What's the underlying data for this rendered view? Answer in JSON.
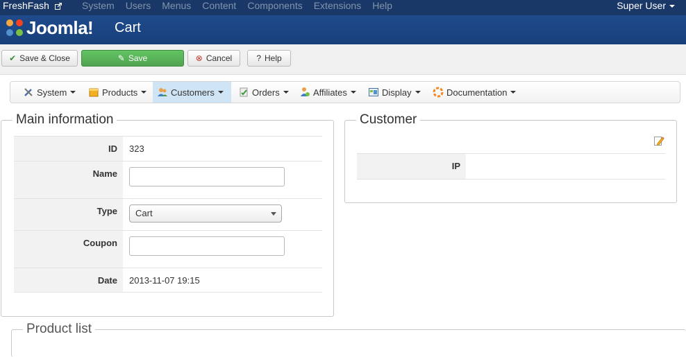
{
  "topbar": {
    "site_name": "FreshFash",
    "menu": [
      "System",
      "Users",
      "Menus",
      "Content",
      "Components",
      "Extensions",
      "Help"
    ],
    "user": "Super User"
  },
  "header": {
    "logo_text": "Joomla!",
    "title": "Cart"
  },
  "toolbar": {
    "save_close": "Save & Close",
    "save": "Save",
    "cancel": "Cancel",
    "help": "Help"
  },
  "submenu": {
    "items": [
      "System",
      "Products",
      "Customers",
      "Orders",
      "Affiliates",
      "Display",
      "Documentation"
    ],
    "active": "Customers"
  },
  "main_info": {
    "legend": "Main information",
    "id_label": "ID",
    "id_value": "323",
    "name_label": "Name",
    "name_value": "",
    "type_label": "Type",
    "type_value": "Cart",
    "coupon_label": "Coupon",
    "coupon_value": "",
    "date_label": "Date",
    "date_value": "2013-11-07 19:15"
  },
  "customer": {
    "legend": "Customer",
    "ip_label": "IP",
    "ip_value": ""
  },
  "product_list": {
    "legend": "Product list"
  },
  "colors": {
    "topbar": "#1a3867",
    "header": "#1f4b8c",
    "save_green": "#5bb75b",
    "active_tab": "#cfe4f5"
  }
}
